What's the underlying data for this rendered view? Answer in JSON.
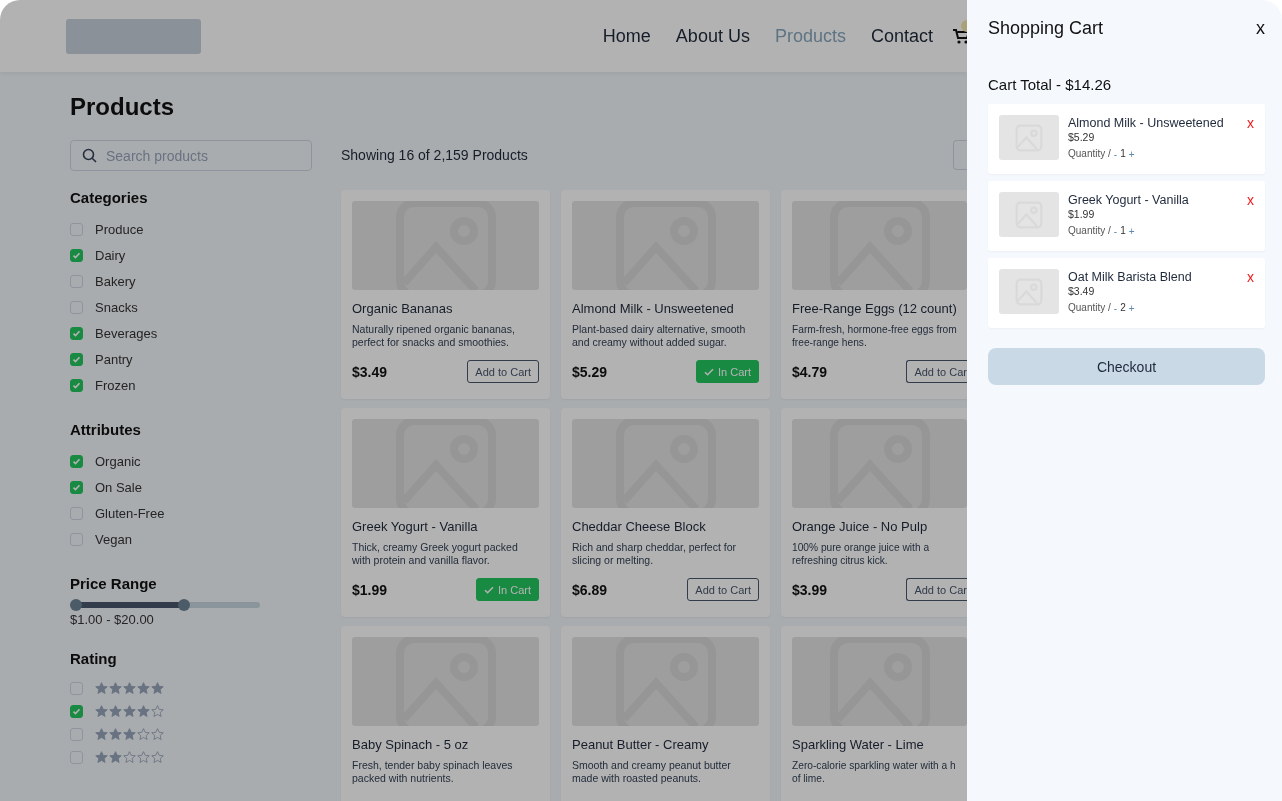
{
  "header": {
    "nav": [
      {
        "label": "Home",
        "selected": false
      },
      {
        "label": "About Us",
        "selected": false
      },
      {
        "label": "Products",
        "selected": true
      },
      {
        "label": "Contact",
        "selected": false
      }
    ]
  },
  "page_title": "Products",
  "search": {
    "placeholder": "Search products"
  },
  "result_count": "Showing 16 of 2,159 Products",
  "filters": [
    {
      "title": "Categories",
      "options": [
        {
          "label": "Produce",
          "checked": false
        },
        {
          "label": "Dairy",
          "checked": true
        },
        {
          "label": "Bakery",
          "checked": false
        },
        {
          "label": "Snacks",
          "checked": false
        },
        {
          "label": "Beverages",
          "checked": true
        },
        {
          "label": "Pantry",
          "checked": true
        },
        {
          "label": "Frozen",
          "checked": true
        }
      ]
    },
    {
      "title": "Attributes",
      "options": [
        {
          "label": "Organic",
          "checked": true
        },
        {
          "label": "On Sale",
          "checked": true
        },
        {
          "label": "Gluten-Free",
          "checked": false
        },
        {
          "label": "Vegan",
          "checked": false
        }
      ]
    }
  ],
  "price_range": {
    "title": "Price Range",
    "thumbs": [
      {
        "level": 0.03
      },
      {
        "level": 0.6
      }
    ],
    "reading": "$1.00 - $20.00"
  },
  "rating": {
    "title": "Rating",
    "options": [
      {
        "stars": 5,
        "checked": false
      },
      {
        "stars": 4,
        "checked": true
      },
      {
        "stars": 3,
        "checked": false
      },
      {
        "stars": 2,
        "checked": false
      }
    ]
  },
  "products": [
    {
      "name": "Organic Bananas",
      "description": "Naturally ripened organic bananas, perfect for snacks and smoothies.",
      "price": "$3.49",
      "button": "Add to Cart",
      "in_cart": false
    },
    {
      "name": "Almond Milk - Unsweetened",
      "description": "Plant-based dairy alternative, smooth and creamy without added sugar.",
      "price": "$5.29",
      "button": "In Cart",
      "in_cart": true
    },
    {
      "name": "Free-Range Eggs (12 count)",
      "description": [
        "Farm-fresh, hormone-free eggs from",
        "free-range hens."
      ],
      "price": "$4.79",
      "button": "Add to Car",
      "in_cart": false
    },
    {
      "name": "Greek Yogurt - Vanilla",
      "description": "Thick, creamy Greek yogurt packed with protein and vanilla flavor.",
      "price": "$1.99",
      "button": "In Cart",
      "in_cart": true
    },
    {
      "name": "Cheddar Cheese Block",
      "description": "Rich and sharp cheddar, perfect for slicing or melting.",
      "price": "$6.89",
      "button": "Add to Cart",
      "in_cart": false
    },
    {
      "name": "Orange Juice - No Pulp",
      "description": [
        "100% pure orange juice with a",
        "refreshing citrus kick."
      ],
      "price": "$3.99",
      "button": "Add to Car",
      "in_cart": false
    },
    {
      "name": "Baby Spinach - 5 oz",
      "description": "Fresh, tender baby spinach leaves packed with nutrients."
    },
    {
      "name": "Peanut Butter - Creamy",
      "description": "Smooth and creamy peanut butter made with roasted peanuts."
    },
    {
      "name": "Sparkling Water - Lime",
      "description": [
        "Zero-calorie sparkling water with a h",
        "of lime."
      ]
    }
  ],
  "cart": {
    "title": "Shopping Cart",
    "close": "x",
    "total": "Cart Total - $14.26",
    "items": [
      {
        "name": "Almond Milk - Unsweetened",
        "price": "$5.29",
        "quantity_label": "Quantity /",
        "minus": "-",
        "quantity": "1",
        "plus": "+",
        "remove": "x"
      },
      {
        "name": "Greek Yogurt - Vanilla",
        "price": "$1.99",
        "quantity_label": "Quantity /",
        "minus": "-",
        "quantity": "1",
        "plus": "+",
        "remove": "x"
      },
      {
        "name": "Oat Milk Barista Blend",
        "price": "$3.49",
        "quantity_label": "Quantity /",
        "minus": "-",
        "quantity": "2",
        "plus": "+",
        "remove": "x"
      }
    ],
    "checkout": "Checkout"
  }
}
